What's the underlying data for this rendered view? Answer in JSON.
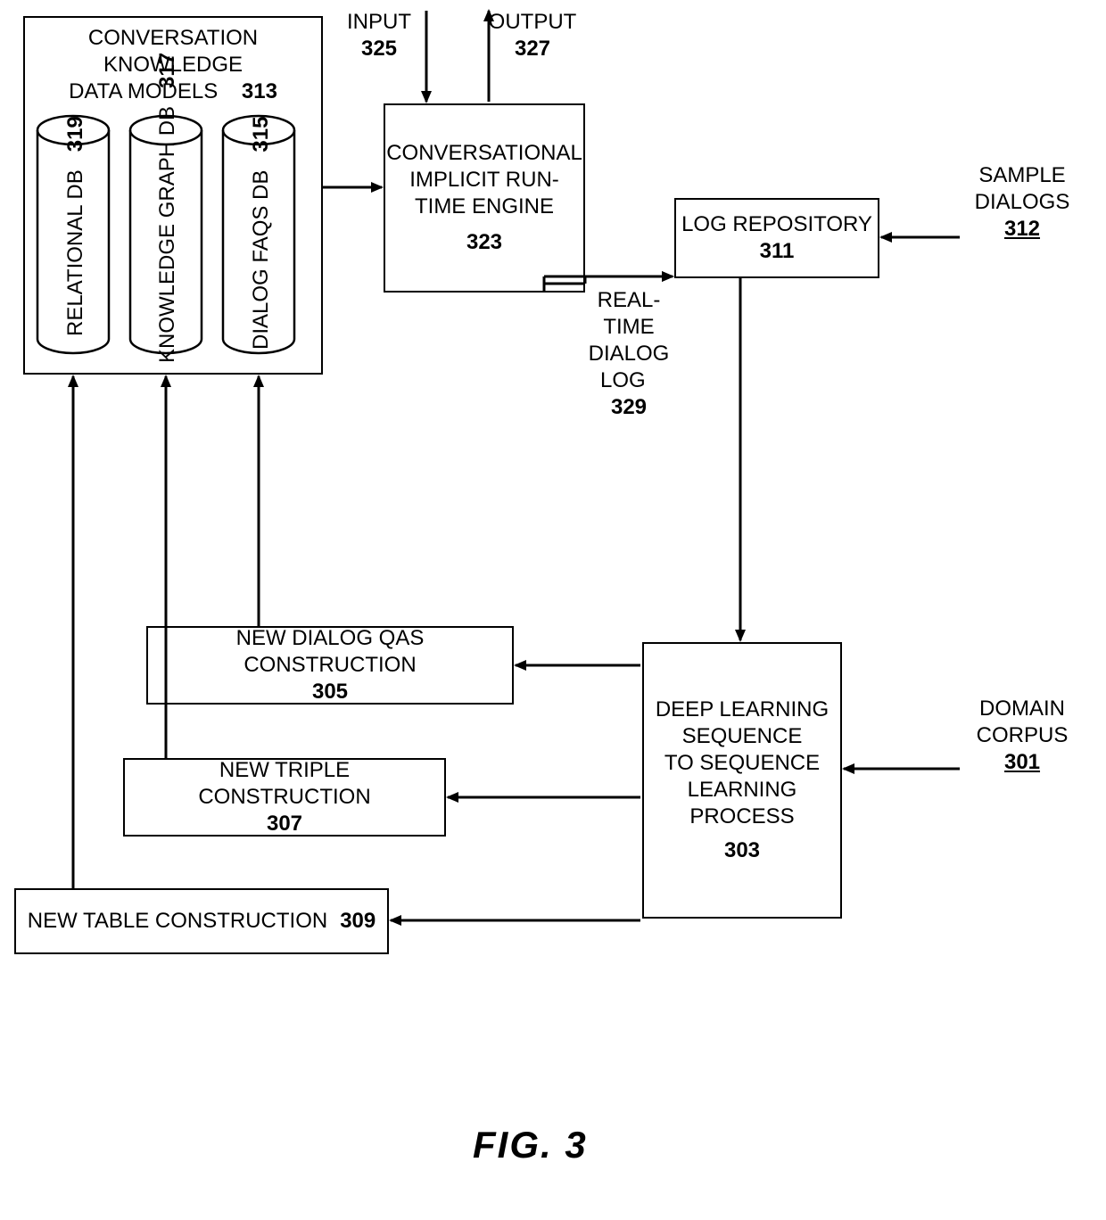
{
  "models": {
    "title_l1": "CONVERSATION",
    "title_l2": "KNOWLEDGE",
    "title_l3": "DATA MODELS",
    "title_num": "313",
    "relational_label": "RELATIONAL DB",
    "relational_num": "319",
    "knowledge_label": "KNOWLEDGE GRAPH DB",
    "knowledge_num": "317",
    "faqs_label": "DIALOG FAQS DB",
    "faqs_num": "315"
  },
  "engine": {
    "l1": "CONVERSATIONAL",
    "l2": "IMPLICIT RUN-",
    "l3": "TIME ENGINE",
    "num": "323"
  },
  "io": {
    "input_label": "INPUT",
    "input_num": "325",
    "output_label": "OUTPUT",
    "output_num": "327"
  },
  "rtlog": {
    "l1": "REAL-",
    "l2": "TIME",
    "l3": "DIALOG",
    "l4": "LOG",
    "num": "329"
  },
  "logrepo": {
    "label": "LOG REPOSITORY",
    "num": "311"
  },
  "sample": {
    "l1": "SAMPLE",
    "l2": "DIALOGS",
    "num": "312"
  },
  "deep": {
    "l1": "DEEP LEARNING",
    "l2": "SEQUENCE",
    "l3": "TO SEQUENCE",
    "l4": "LEARNING",
    "l5": "PROCESS",
    "num": "303"
  },
  "domain": {
    "l1": "DOMAIN",
    "l2": "CORPUS",
    "num": "301"
  },
  "qas": {
    "label": "NEW DIALOG QAS CONSTRUCTION",
    "num": "305"
  },
  "triple": {
    "label": "NEW TRIPLE CONSTRUCTION",
    "num": "307"
  },
  "table": {
    "label": "NEW TABLE CONSTRUCTION",
    "num": "309"
  },
  "figure": "FIG. 3"
}
